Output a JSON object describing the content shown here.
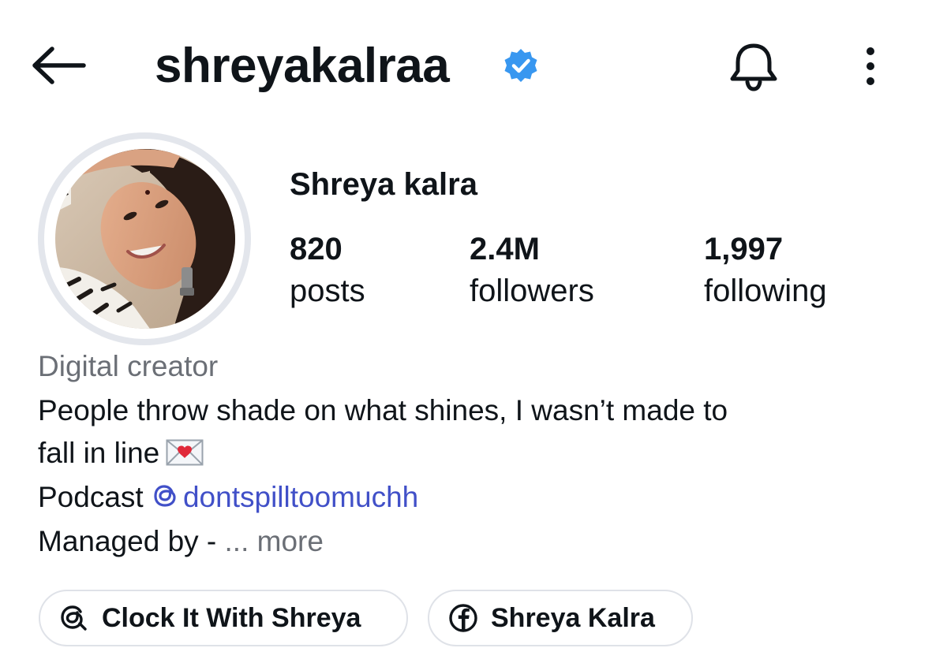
{
  "header": {
    "username": "shreyakalraa",
    "verified": true,
    "back_icon": "arrow-left-icon",
    "bell_icon": "bell-icon",
    "more_icon": "more-vertical-icon",
    "verified_color": "#3897f0"
  },
  "profile": {
    "display_name": "Shreya kalra",
    "stats": {
      "posts": {
        "value": "820",
        "label": "posts"
      },
      "followers": {
        "value": "2.4M",
        "label": "followers"
      },
      "following": {
        "value": "1,997",
        "label": "following"
      }
    }
  },
  "bio": {
    "category": "Digital creator",
    "line1": "People throw shade on what shines, I wasn’t made to",
    "line2": "fall in line",
    "line2_emoji": "love-letter-icon",
    "line3_prefix": "Podcast ",
    "line3_handle": "dontspilltoomuchh",
    "line3_handle_icon": "threads-icon",
    "line4_text": "Managed by - ",
    "line4_more": "... more",
    "link_color": "#4150c8",
    "muted_color": "#6b6f76"
  },
  "links": [
    {
      "label": "Clock It With Shreya",
      "icon": "threads-icon"
    },
    {
      "label": "Shreya Kalra",
      "icon": "facebook-icon"
    }
  ]
}
